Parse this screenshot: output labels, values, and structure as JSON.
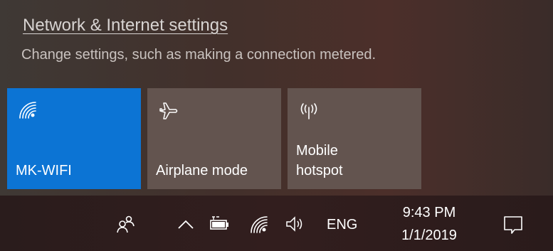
{
  "panel": {
    "settings_link": "Network & Internet settings",
    "settings_description": "Change settings, such as making a connection metered.",
    "tiles": [
      {
        "label": "MK-WIFI",
        "icon": "wifi-icon",
        "active": true
      },
      {
        "label": "Airplane mode",
        "icon": "airplane-icon",
        "active": false
      },
      {
        "label": "Mobile\nhotspot",
        "icon": "mobile-hotspot-icon",
        "active": false
      }
    ]
  },
  "taskbar": {
    "language": "ENG",
    "time": "9:43 PM",
    "date": "1/1/2019",
    "icons": [
      "people-icon",
      "chevron-up-icon",
      "battery-icon",
      "wifi-icon",
      "volume-icon",
      "action-center-icon"
    ]
  },
  "colors": {
    "accent": "#0c74d4",
    "tile": "#63544f"
  }
}
